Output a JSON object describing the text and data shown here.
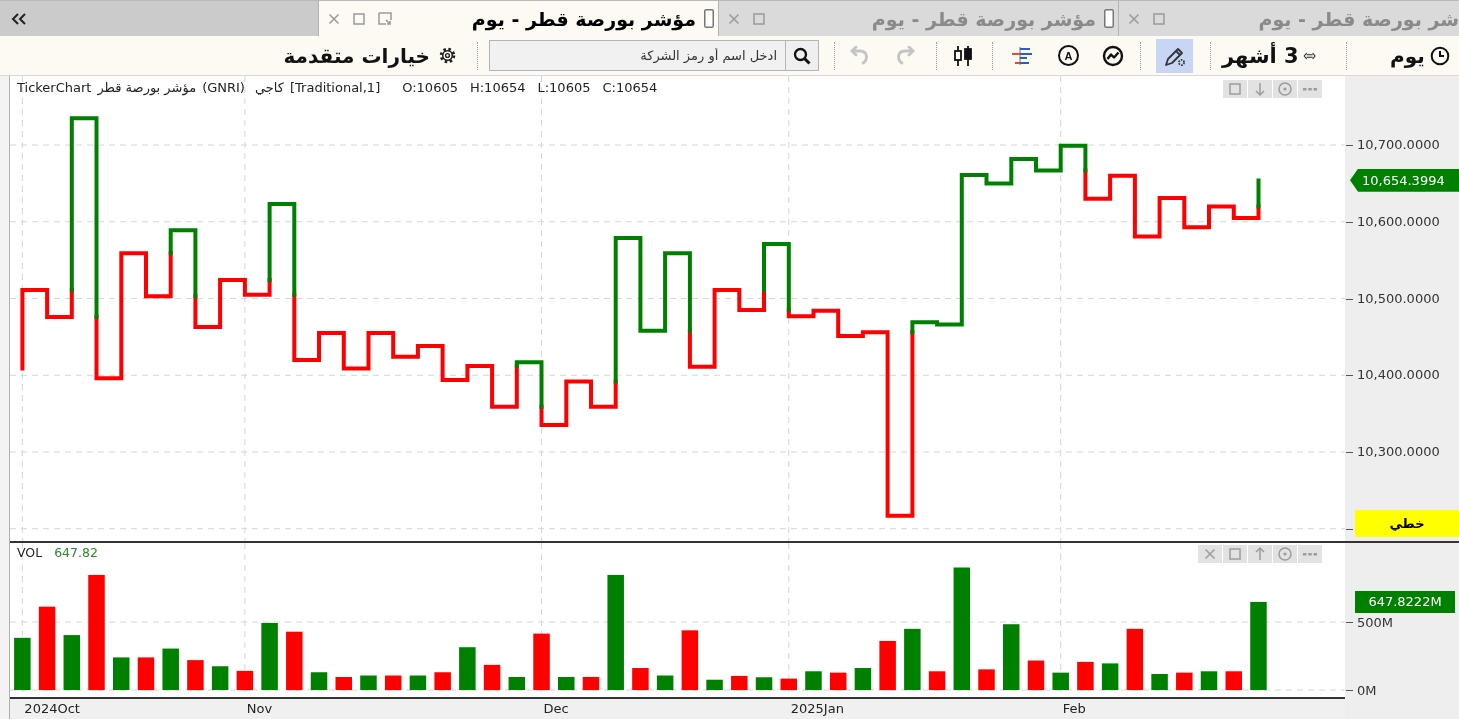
{
  "tabs": [
    {
      "title": "شر بورصة قطر - يوم",
      "selected": false
    },
    {
      "title": "مؤشر بورصة قطر - يوم",
      "selected": false
    },
    {
      "title": "مؤشر بورصة قطر - يوم",
      "selected": true
    }
  ],
  "toolbar": {
    "advanced_options": "خيارات متقدمة",
    "search": {
      "placeholder": "ادخل اسم أو رمز الشركة"
    },
    "undo": {
      "disabled": true
    },
    "redo": {
      "disabled": true
    },
    "circled_letter": "A",
    "drawing_tool": {
      "selected": true
    },
    "range": "3 أشهر",
    "period": "يوم"
  },
  "price_panel": {
    "legend": {
      "source": "TickerChart",
      "name": "مؤشر بورصة قطر",
      "symbol": "(GNRI)",
      "chart_type": "كاجي",
      "params": "[Traditional,1]",
      "ohlc": [
        "C:10654",
        "L:10605",
        "H:10654",
        "O:10605"
      ]
    },
    "axis_labels": [
      "10,700.0000",
      "10,600.0000",
      "10,500.0000",
      "10,400.0000",
      "10,300.0000"
    ],
    "last_value": "10,654.3994",
    "scale_mode": "خطي"
  },
  "volume_panel": {
    "legend": {
      "name": "VOL",
      "value": "647.82"
    },
    "last_value": "647.8222M",
    "chart_data": {
      "type": "bar",
      "grid": true,
      "categories": [
        null,
        null,
        null,
        null,
        null,
        null,
        null,
        null,
        null,
        null,
        null,
        null,
        null,
        null,
        null,
        null,
        null,
        null,
        null,
        null,
        null,
        null,
        null,
        null,
        null,
        null,
        null,
        null,
        null,
        null,
        null,
        null,
        null,
        null,
        null,
        null,
        null,
        null,
        null,
        null,
        null,
        null,
        null,
        null,
        null,
        null,
        null,
        null,
        null,
        null,
        null,
        null,
        null,
        null
      ],
      "series": [
        {
          "values": [
            384,
            613,
            404,
            846,
            240,
            240,
            305,
            220,
            175,
            141,
            493,
            429,
            131,
            96,
            107,
            107,
            107,
            131,
            315,
            185,
            96,
            415,
            96,
            96,
            846,
            162,
            107,
            439,
            76,
            104,
            94,
            84,
            138,
            128,
            162,
            361,
            450,
            138,
            901,
            152,
            484,
            217,
            128,
            207,
            196,
            450,
            118,
            128,
            138,
            138,
            648,
            null,
            null,
            null
          ]
        }
      ],
      "ylim": [
        -51,
        1081
      ],
      "yticks": [
        {
          "value": 0,
          "label": "0M"
        },
        {
          "value": 500,
          "label": "500M"
        }
      ]
    }
  },
  "time_axis": [
    "Feb",
    "2025Jan",
    "Dec",
    "Nov",
    "2024Oct"
  ]
}
